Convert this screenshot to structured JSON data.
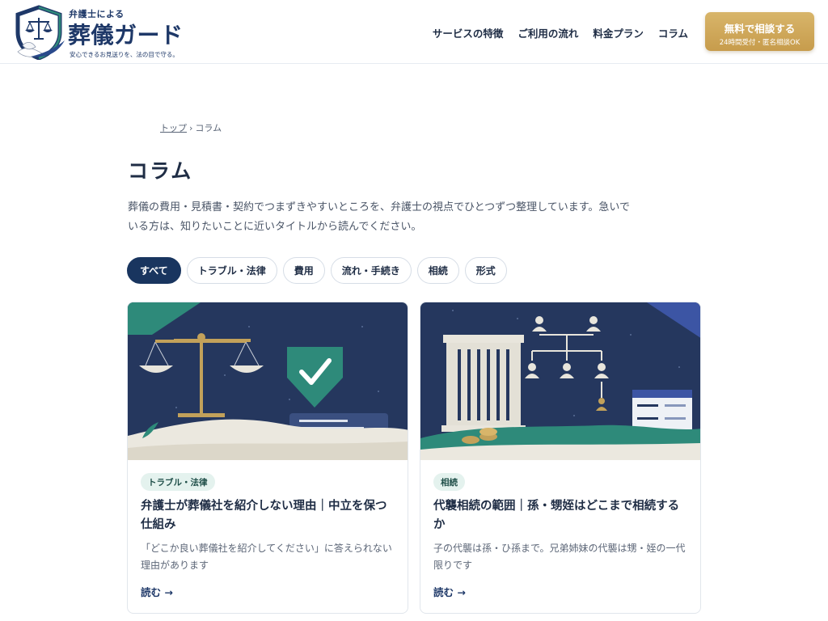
{
  "header": {
    "logo": {
      "small": "弁護士による",
      "main": "葬儀ガード",
      "tagline": "安心できるお見送りを、法の目で守る。"
    },
    "nav": [
      {
        "label": "サービスの特徴"
      },
      {
        "label": "ご利用の流れ"
      },
      {
        "label": "料金プラン"
      },
      {
        "label": "コラム"
      }
    ],
    "cta": {
      "main": "無料で相談する",
      "sub": "24時間受付・匿名相談OK"
    }
  },
  "breadcrumb": {
    "home": "トップ",
    "separator": "›",
    "current": "コラム"
  },
  "page": {
    "title": "コラム",
    "lead": "葬儀の費用・見積書・契約でつまずきやすいところを、弁護士の視点でひとつずつ整理しています。急いでいる方は、知りたいことに近いタイトルから読んでください。"
  },
  "filters": [
    {
      "label": "すべて",
      "active": true
    },
    {
      "label": "トラブル・法律",
      "active": false
    },
    {
      "label": "費用",
      "active": false
    },
    {
      "label": "流れ・手続き",
      "active": false
    },
    {
      "label": "相続",
      "active": false
    },
    {
      "label": "形式",
      "active": false
    }
  ],
  "cards": [
    {
      "category": "トラブル・法律",
      "title": "弁護士が葬儀社を紹介しない理由｜中立を保つ仕組み",
      "description": "「どこか良い葬儀社を紹介してください」に答えられない理由があります",
      "link": "読む →",
      "image_icon": "scales-shield-icon"
    },
    {
      "category": "相続",
      "title": "代襲相続の範囲｜孫・甥姪はどこまで相続するか",
      "description": "子の代襲は孫・ひ孫まで。兄弟姉妹の代襲は甥・姪の一代限りです",
      "link": "読む →",
      "image_icon": "family-tree-icon"
    }
  ],
  "colors": {
    "navy": "#1e3868",
    "active_chip": "#19355f",
    "gold": "#d2ad60",
    "badge_bg": "#e4f2ee",
    "illustration_bg": "#25375e",
    "teal": "#2e8a7a"
  }
}
